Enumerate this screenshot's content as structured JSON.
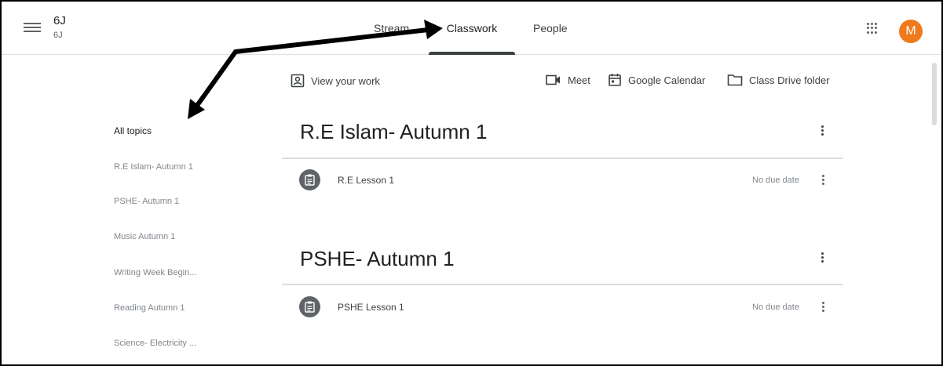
{
  "header": {
    "class_name": "6J",
    "class_section": "6J",
    "tabs": [
      {
        "label": "Stream"
      },
      {
        "label": "Classwork"
      },
      {
        "label": "People"
      }
    ],
    "avatar_initial": "M",
    "avatar_color": "#ef7a1c"
  },
  "toolbar": {
    "view_work": "View your work",
    "meet": "Meet",
    "google_calendar": "Google Calendar",
    "drive_folder": "Class Drive folder"
  },
  "sidebar": {
    "topics": [
      {
        "label": "All topics"
      },
      {
        "label": "R.E Islam- Autumn 1"
      },
      {
        "label": "PSHE- Autumn 1"
      },
      {
        "label": "Music Autumn 1"
      },
      {
        "label": "Writing Week Begin..."
      },
      {
        "label": "Reading Autumn 1"
      },
      {
        "label": "Science- Electricity ..."
      }
    ]
  },
  "sections": [
    {
      "title": "R.E Islam- Autumn 1",
      "items": [
        {
          "title": "R.E Lesson 1",
          "due": "No due date"
        }
      ]
    },
    {
      "title": "PSHE- Autumn 1",
      "items": [
        {
          "title": "PSHE Lesson 1",
          "due": "No due date"
        }
      ]
    }
  ],
  "icons": {
    "menu": "hamburger-menu-icon",
    "apps": "apps-grid-icon",
    "view_work": "account-box-icon",
    "meet": "video-camera-icon",
    "calendar": "calendar-icon",
    "drive": "folder-icon",
    "assignment": "assignment-clipboard-icon"
  }
}
